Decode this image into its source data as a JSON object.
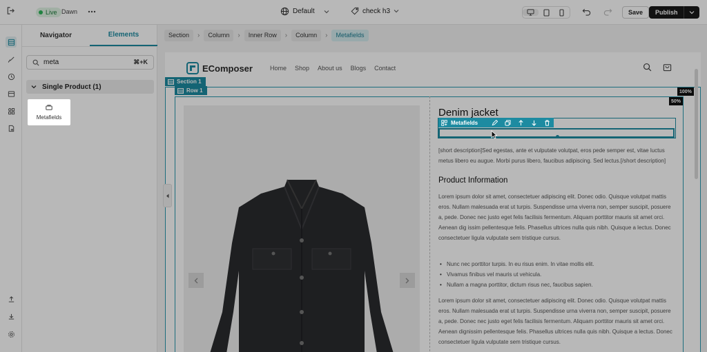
{
  "topbar": {
    "live_label": "Live",
    "theme_name": "Dawn",
    "device": "Default",
    "page": "check h3",
    "save_label": "Save",
    "publish_label": "Publish"
  },
  "panel": {
    "tabs": [
      "Navigator",
      "Elements"
    ],
    "active_tab": "Elements",
    "search_value": "meta",
    "search_shortcut": "⌘+K",
    "group_title": "Single Product (1)",
    "element_label": "Metafields"
  },
  "breadcrumb": [
    "Section",
    "Column",
    "Inner Row",
    "Column",
    "Metafields"
  ],
  "site": {
    "logo": "EComposer",
    "nav": [
      "Home",
      "Shop",
      "About us",
      "Blogs",
      "Contact"
    ]
  },
  "builder": {
    "section_tag": "Section 1",
    "row_tag": "Row 1",
    "pct_full": "100%",
    "pct_half": "50%",
    "toolbar_label": "Metafields"
  },
  "product": {
    "title": "Denim jacket",
    "short_desc": "[short description]Sed egestas, ante et vulputate volutpat, eros pede semper est, vitae luctus metus libero eu augue. Morbi purus libero, faucibus adipiscing. Sed lectus.[/short description]",
    "info_title": "Product Information",
    "para1": "Lorem ipsum dolor sit amet, consectetuer adipiscing elit. Donec odio. Quisque volutpat mattis eros. Nullam malesuada erat ut turpis. Suspendisse urna viverra non, semper suscipit, posuere a, pede. Donec nec justo eget felis facilisis fermentum. Aliquam porttitor mauris sit amet orci. Aenean dig issim pellentesque felis. Phasellus ultrices nulla quis nibh. Quisque a lectus. Donec consectetuer ligula vulputate sem tristique cursus.",
    "bullets": [
      "Nunc nec porttitor turpis. In eu risus enim. In vitae mollis elit.",
      "Vivamus finibus vel mauris ut vehicula.",
      "Nullam a magna porttitor, dictum risus nec, faucibus sapien."
    ],
    "para2": "Lorem ipsum dolor sit amet, consectetuer adipiscing elit. Donec odio. Quisque volutpat mattis eros. Nullam malesuada erat ut turpis. Suspendisse urna viverra non, semper suscipit, posuere a, pede. Donec nec justo eget felis facilisis fermentum. Aliquam porttitor mauris sit amet orci. Aenean dignissim pellentesque felis. Phasellus ultrices nulla quis nibh. Quisque a lectus. Donec consectetuer ligula vulputate sem tristique cursus."
  },
  "colors": {
    "accent": "#1d8ba1",
    "live": "#2fb45a",
    "publish": "#1a1a1a"
  }
}
